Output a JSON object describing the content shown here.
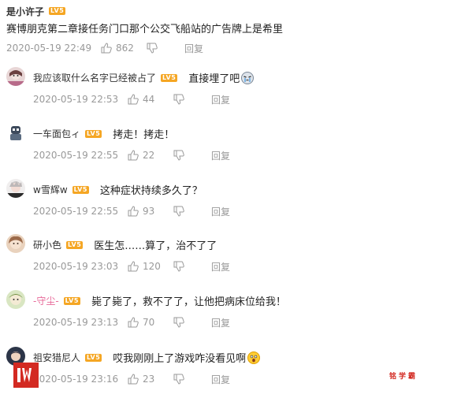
{
  "main_comment": {
    "username": "是小许子",
    "level": "LV5",
    "text": "赛博朋克第二章接任务门口那个公交飞船站的广告牌上是希里",
    "time": "2020-05-19 22:49",
    "likes": "862",
    "reply_label": "回复"
  },
  "replies": [
    {
      "username": "我应该取什么名字已经被占了",
      "level": "LV5",
      "text": "直接埋了吧",
      "time": "2020-05-19 22:53",
      "likes": "44",
      "reply_label": "回复"
    },
    {
      "username": "一车面包ィ",
      "level": "LV5",
      "text": "拷走！拷走！",
      "time": "2020-05-19 22:55",
      "likes": "22",
      "reply_label": "回复"
    },
    {
      "username": "w雪辉w",
      "level": "LV5",
      "text": "这种症状持续多久了？",
      "time": "2020-05-19 22:55",
      "likes": "93",
      "reply_label": "回复"
    },
    {
      "username": "研小色",
      "level": "LV5",
      "text": "医生怎……算了，治不了了",
      "time": "2020-05-19 23:03",
      "likes": "120",
      "reply_label": "回复"
    },
    {
      "username": "-守尘-",
      "level": "LV5",
      "text": "毙了毙了，救不了了，让他把病床位给我！",
      "time": "2020-05-19 23:13",
      "likes": "70",
      "reply_label": "回复"
    },
    {
      "username": "祖安猎尼人",
      "level": "LV5",
      "text": "哎我刚刚上了游戏咋没看见啊",
      "time": "2020-05-19 23:16",
      "likes": "23",
      "reply_label": "回复"
    }
  ],
  "watermark": "铭学霸",
  "colors": {
    "level_badge": "#f5a623",
    "meta_text": "#999999",
    "pink_name": "#e86b9a",
    "logo_red": "#d32a22"
  }
}
